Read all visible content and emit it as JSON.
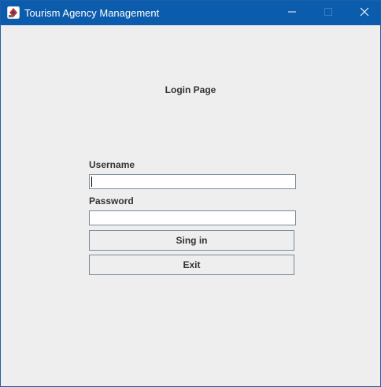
{
  "window": {
    "title": "Tourism Agency Management",
    "icons": {
      "app": "app-icon",
      "minimize": "minimize-icon",
      "maximize": "maximize-icon",
      "close": "close-icon"
    },
    "colors": {
      "titlebar": "#0b5cad",
      "background": "#eeeeee"
    }
  },
  "login": {
    "page_title": "Login Page",
    "username_label": "Username",
    "username_value": "",
    "password_label": "Password",
    "password_value": "",
    "signin_label": "Sing in",
    "exit_label": "Exit"
  }
}
